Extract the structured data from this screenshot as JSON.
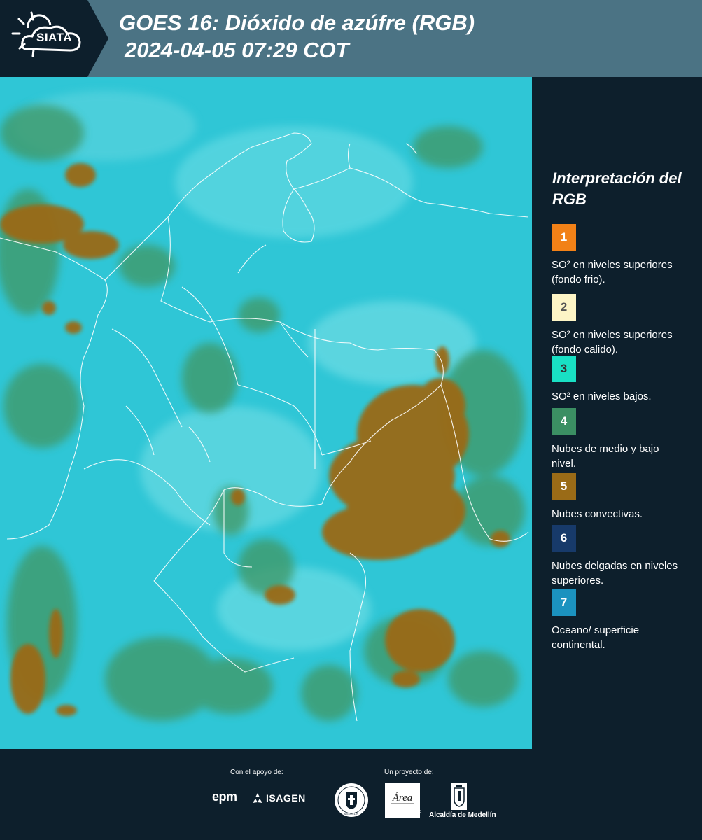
{
  "header": {
    "logo_text": "SIATA",
    "title": "GOES 16: Dióxido de azúfre (RGB)",
    "subtitle": "2024-04-05 07:29 COT"
  },
  "legend": {
    "title": "Interpretación del RGB",
    "items": [
      {
        "number": "1",
        "label": "SO² en niveles superiores (fondo frio).",
        "color": "#f28117",
        "text_color": "#ffffff"
      },
      {
        "number": "2",
        "label": "SO² en niveles superiores (fondo calido).",
        "color": "#fdf5c6",
        "text_color": "#555555"
      },
      {
        "number": "3",
        "label": "SO² en niveles bajos.",
        "color": "#19e0c4",
        "text_color": "#333333"
      },
      {
        "number": "4",
        "label": "Nubes de medio y bajo nivel.",
        "color": "#3b8f63",
        "text_color": "#ffffff"
      },
      {
        "number": "5",
        "label": "Nubes convectivas.",
        "color": "#9a6b17",
        "text_color": "#ffffff"
      },
      {
        "number": "6",
        "label": "Nubes delgadas en niveles superiores.",
        "color": "#173a6a",
        "text_color": "#ffffff"
      },
      {
        "number": "7",
        "label": "Oceano/ superficie continental.",
        "color": "#1b92bf",
        "text_color": "#ffffff"
      }
    ]
  },
  "footer": {
    "support_label": "Con el apoyo de:",
    "project_label": "Un proyecto de:",
    "epm_logo": "epm",
    "isagen_logo": "ISAGEN",
    "seal_logo": "MEDELLÍN",
    "area_logo": "Área",
    "area_subtext": "METROPOLITANA Valle de Aburrá",
    "alcaldia_logo": "Alcaldía de Medellín"
  },
  "colors": {
    "header_bg": "#4b7384",
    "page_bg": "#0d1f2c",
    "map_cyan": "#2fc6d6",
    "cloud_green": "#3f9a6a",
    "cloud_brown": "#9a6b17"
  }
}
